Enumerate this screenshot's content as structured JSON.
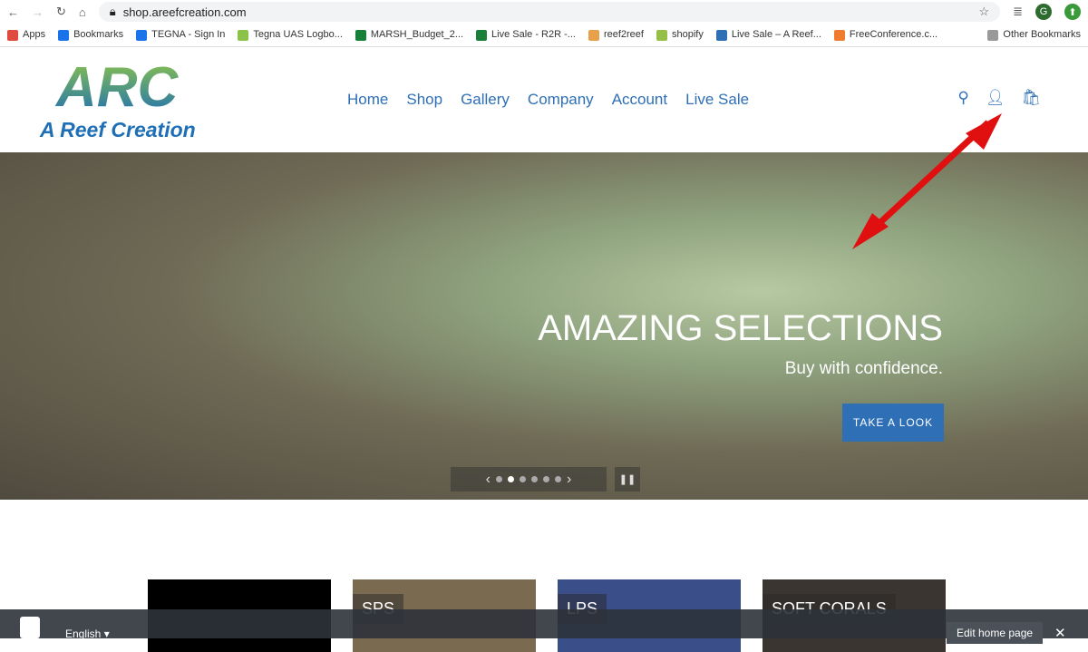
{
  "browser": {
    "url": "shop.areefcreation.com",
    "avatar": "G",
    "bookmarks": [
      {
        "label": "Apps",
        "color": "#e04a3f"
      },
      {
        "label": "Bookmarks",
        "color": "#1a73e8"
      },
      {
        "label": "TEGNA - Sign In",
        "color": "#1a73e8"
      },
      {
        "label": "Tegna UAS Logbo...",
        "color": "#8bc34a"
      },
      {
        "label": "MARSH_Budget_2...",
        "color": "#188038"
      },
      {
        "label": "Live Sale - R2R -...",
        "color": "#188038"
      },
      {
        "label": "reef2reef",
        "color": "#e8a04a"
      },
      {
        "label": "shopify",
        "color": "#95bf47"
      },
      {
        "label": "Live Sale – A Reef...",
        "color": "#2e6fb5"
      },
      {
        "label": "FreeConference.c...",
        "color": "#f07a2e"
      }
    ],
    "other_bookmarks": "Other Bookmarks"
  },
  "site": {
    "logo_mark": "ARC",
    "logo_name": "A Reef Creation",
    "nav": [
      "Home",
      "Shop",
      "Gallery",
      "Company",
      "Account",
      "Live Sale"
    ]
  },
  "hero": {
    "title": "AMAZING SELECTIONS",
    "subtitle": "Buy with confidence.",
    "cta": "TAKE A LOOK",
    "slides": 6,
    "active_slide": 2
  },
  "collections": [
    {
      "label": ""
    },
    {
      "label": "SPS"
    },
    {
      "label": "LPS"
    },
    {
      "label": "SOFT CORALS"
    }
  ],
  "shopify_bar": {
    "language": "English",
    "edit": "Edit home page"
  }
}
